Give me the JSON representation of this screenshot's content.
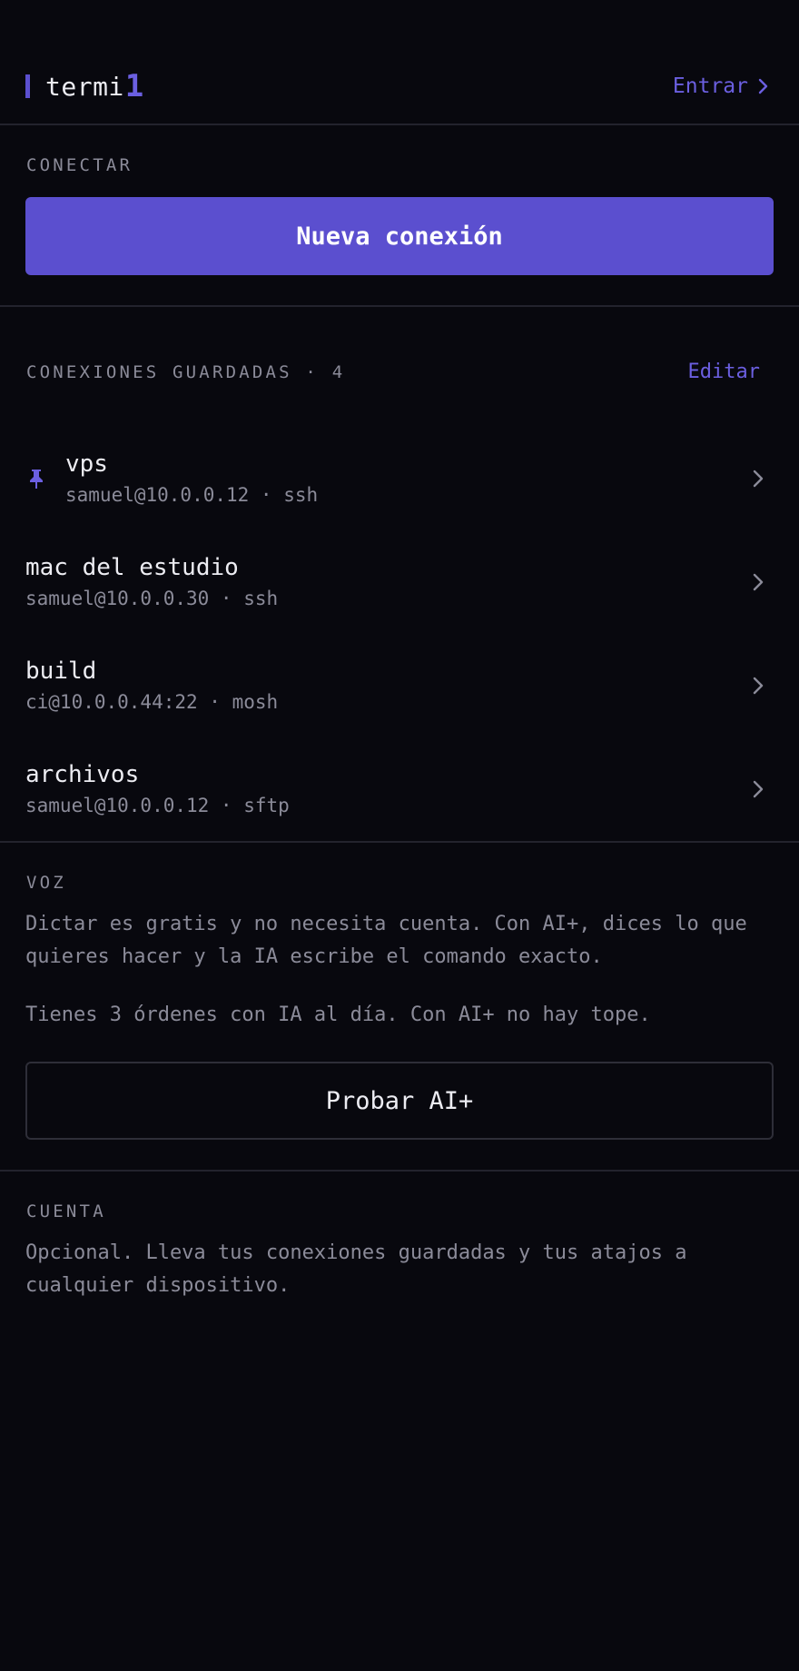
{
  "header": {
    "brand_text": "termi",
    "brand_cursor": "1",
    "signin_label": "Entrar"
  },
  "connect": {
    "label": "CONECTAR",
    "new_button": "Nueva conexión"
  },
  "saved": {
    "label": "CONEXIONES GUARDADAS · 4",
    "edit_label": "Editar",
    "items": [
      {
        "name": "vps",
        "meta": "samuel@10.0.0.12 · ssh",
        "pinned": true
      },
      {
        "name": "mac del estudio",
        "meta": "samuel@10.0.0.30 · ssh",
        "pinned": false
      },
      {
        "name": "build",
        "meta": "ci@10.0.0.44:22 · mosh",
        "pinned": false
      },
      {
        "name": "archivos",
        "meta": "samuel@10.0.0.12 · sftp",
        "pinned": false
      }
    ]
  },
  "voice": {
    "label": "VOZ",
    "description": "Dictar es gratis y no necesita cuenta. Con AI+, dices lo que quieres hacer y la IA escribe el comando exacto.",
    "quota": "Tienes 3 órdenes con IA al día. Con AI+ no hay tope.",
    "try_button": "Probar AI+"
  },
  "account": {
    "label": "CUENTA",
    "description": "Opcional. Lleva tus conexiones guardadas y tus atajos a cualquier dispositivo."
  },
  "colors": {
    "background": "#08080e",
    "accent": "#5b4fcf",
    "text": "#ececf2",
    "muted": "#8b8b99",
    "divider": "#23232d"
  },
  "icons": {
    "signin": "chevron-right-icon",
    "pinned": "pin-icon",
    "row": "chevron-right-icon"
  }
}
